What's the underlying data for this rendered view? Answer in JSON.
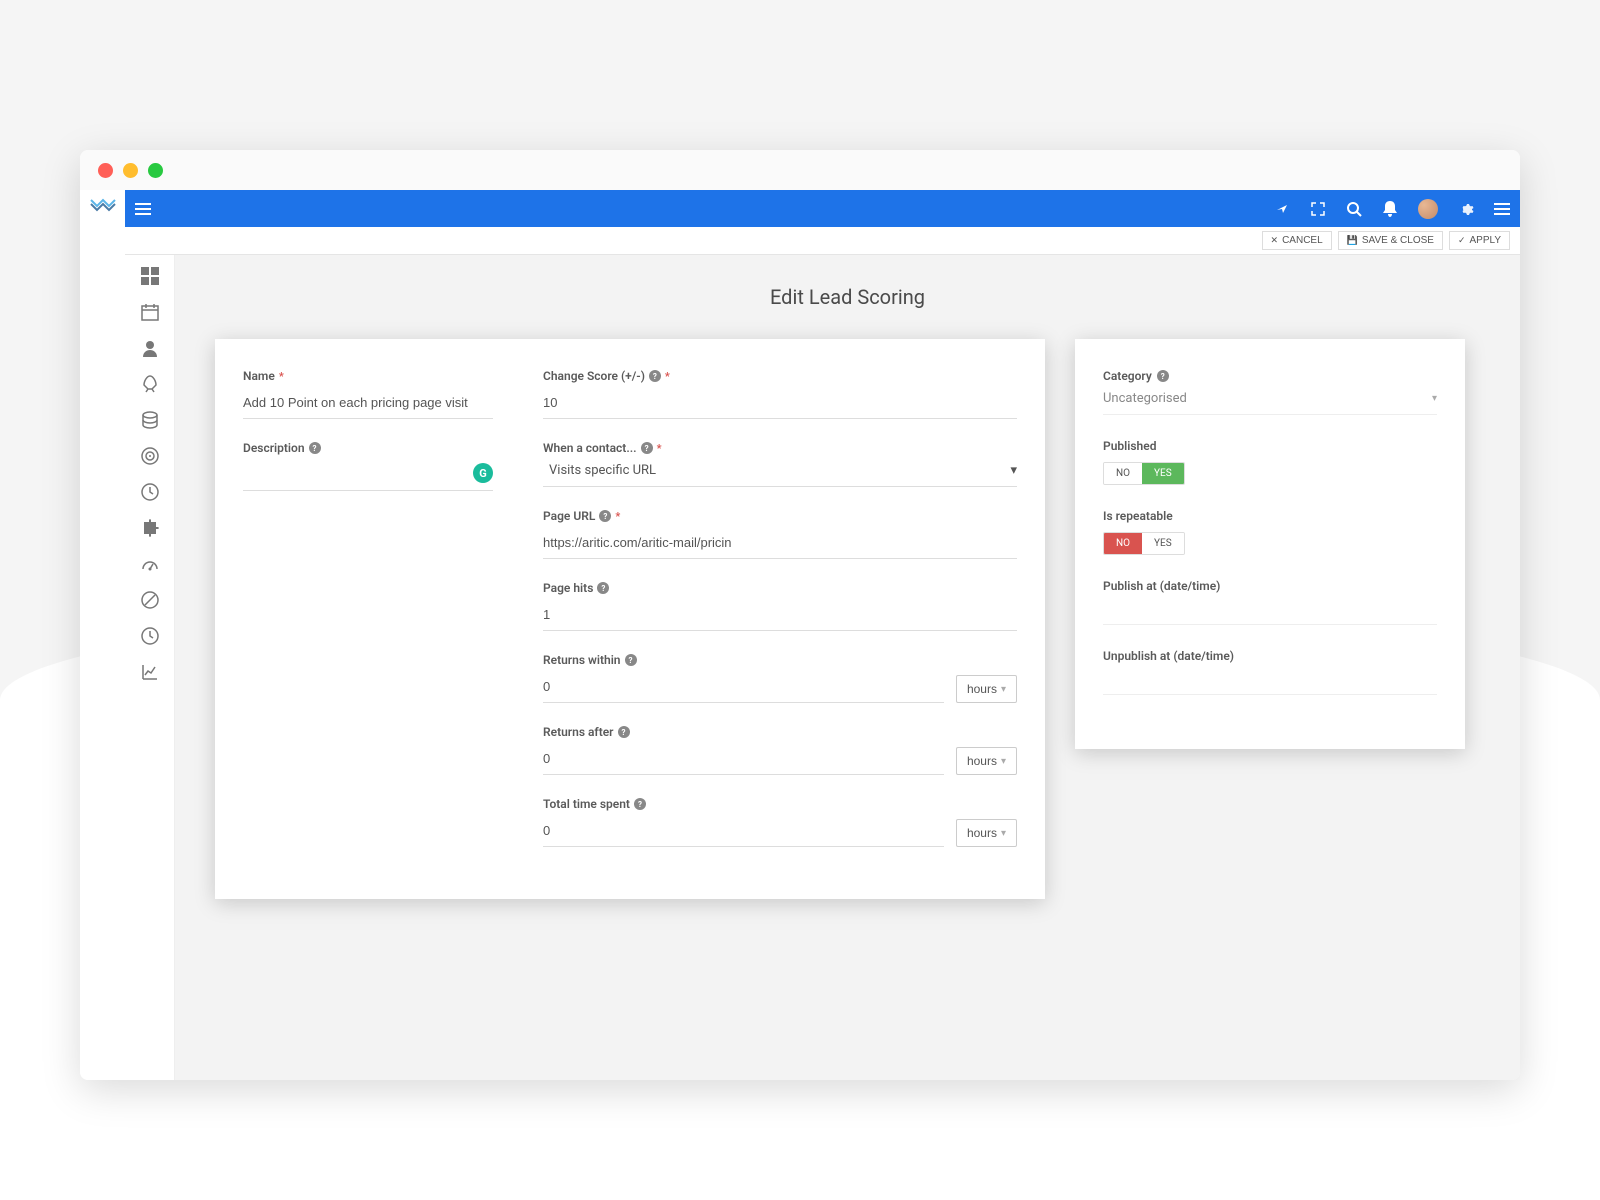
{
  "page": {
    "title": "Edit Lead Scoring"
  },
  "actions": {
    "cancel": "CANCEL",
    "save_close": "SAVE & CLOSE",
    "apply": "APPLY"
  },
  "form": {
    "name": {
      "label": "Name",
      "value": "Add 10 Point on each pricing page visit"
    },
    "description": {
      "label": "Description"
    },
    "change_score": {
      "label": "Change Score (+/-)",
      "value": "10"
    },
    "when_contact": {
      "label": "When a contact...",
      "value": "Visits specific URL"
    },
    "page_url": {
      "label": "Page URL",
      "value": "https://aritic.com/aritic-mail/pricin"
    },
    "page_hits": {
      "label": "Page hits",
      "value": "1"
    },
    "returns_within": {
      "label": "Returns within",
      "value": "0",
      "unit": "hours"
    },
    "returns_after": {
      "label": "Returns after",
      "value": "0",
      "unit": "hours"
    },
    "total_time": {
      "label": "Total time spent",
      "value": "0",
      "unit": "hours"
    }
  },
  "side": {
    "category": {
      "label": "Category",
      "value": "Uncategorised"
    },
    "published": {
      "label": "Published",
      "no": "NO",
      "yes": "YES"
    },
    "repeatable": {
      "label": "Is repeatable",
      "no": "NO",
      "yes": "YES"
    },
    "publish_at": {
      "label": "Publish at (date/time)"
    },
    "unpublish_at": {
      "label": "Unpublish at (date/time)"
    }
  }
}
